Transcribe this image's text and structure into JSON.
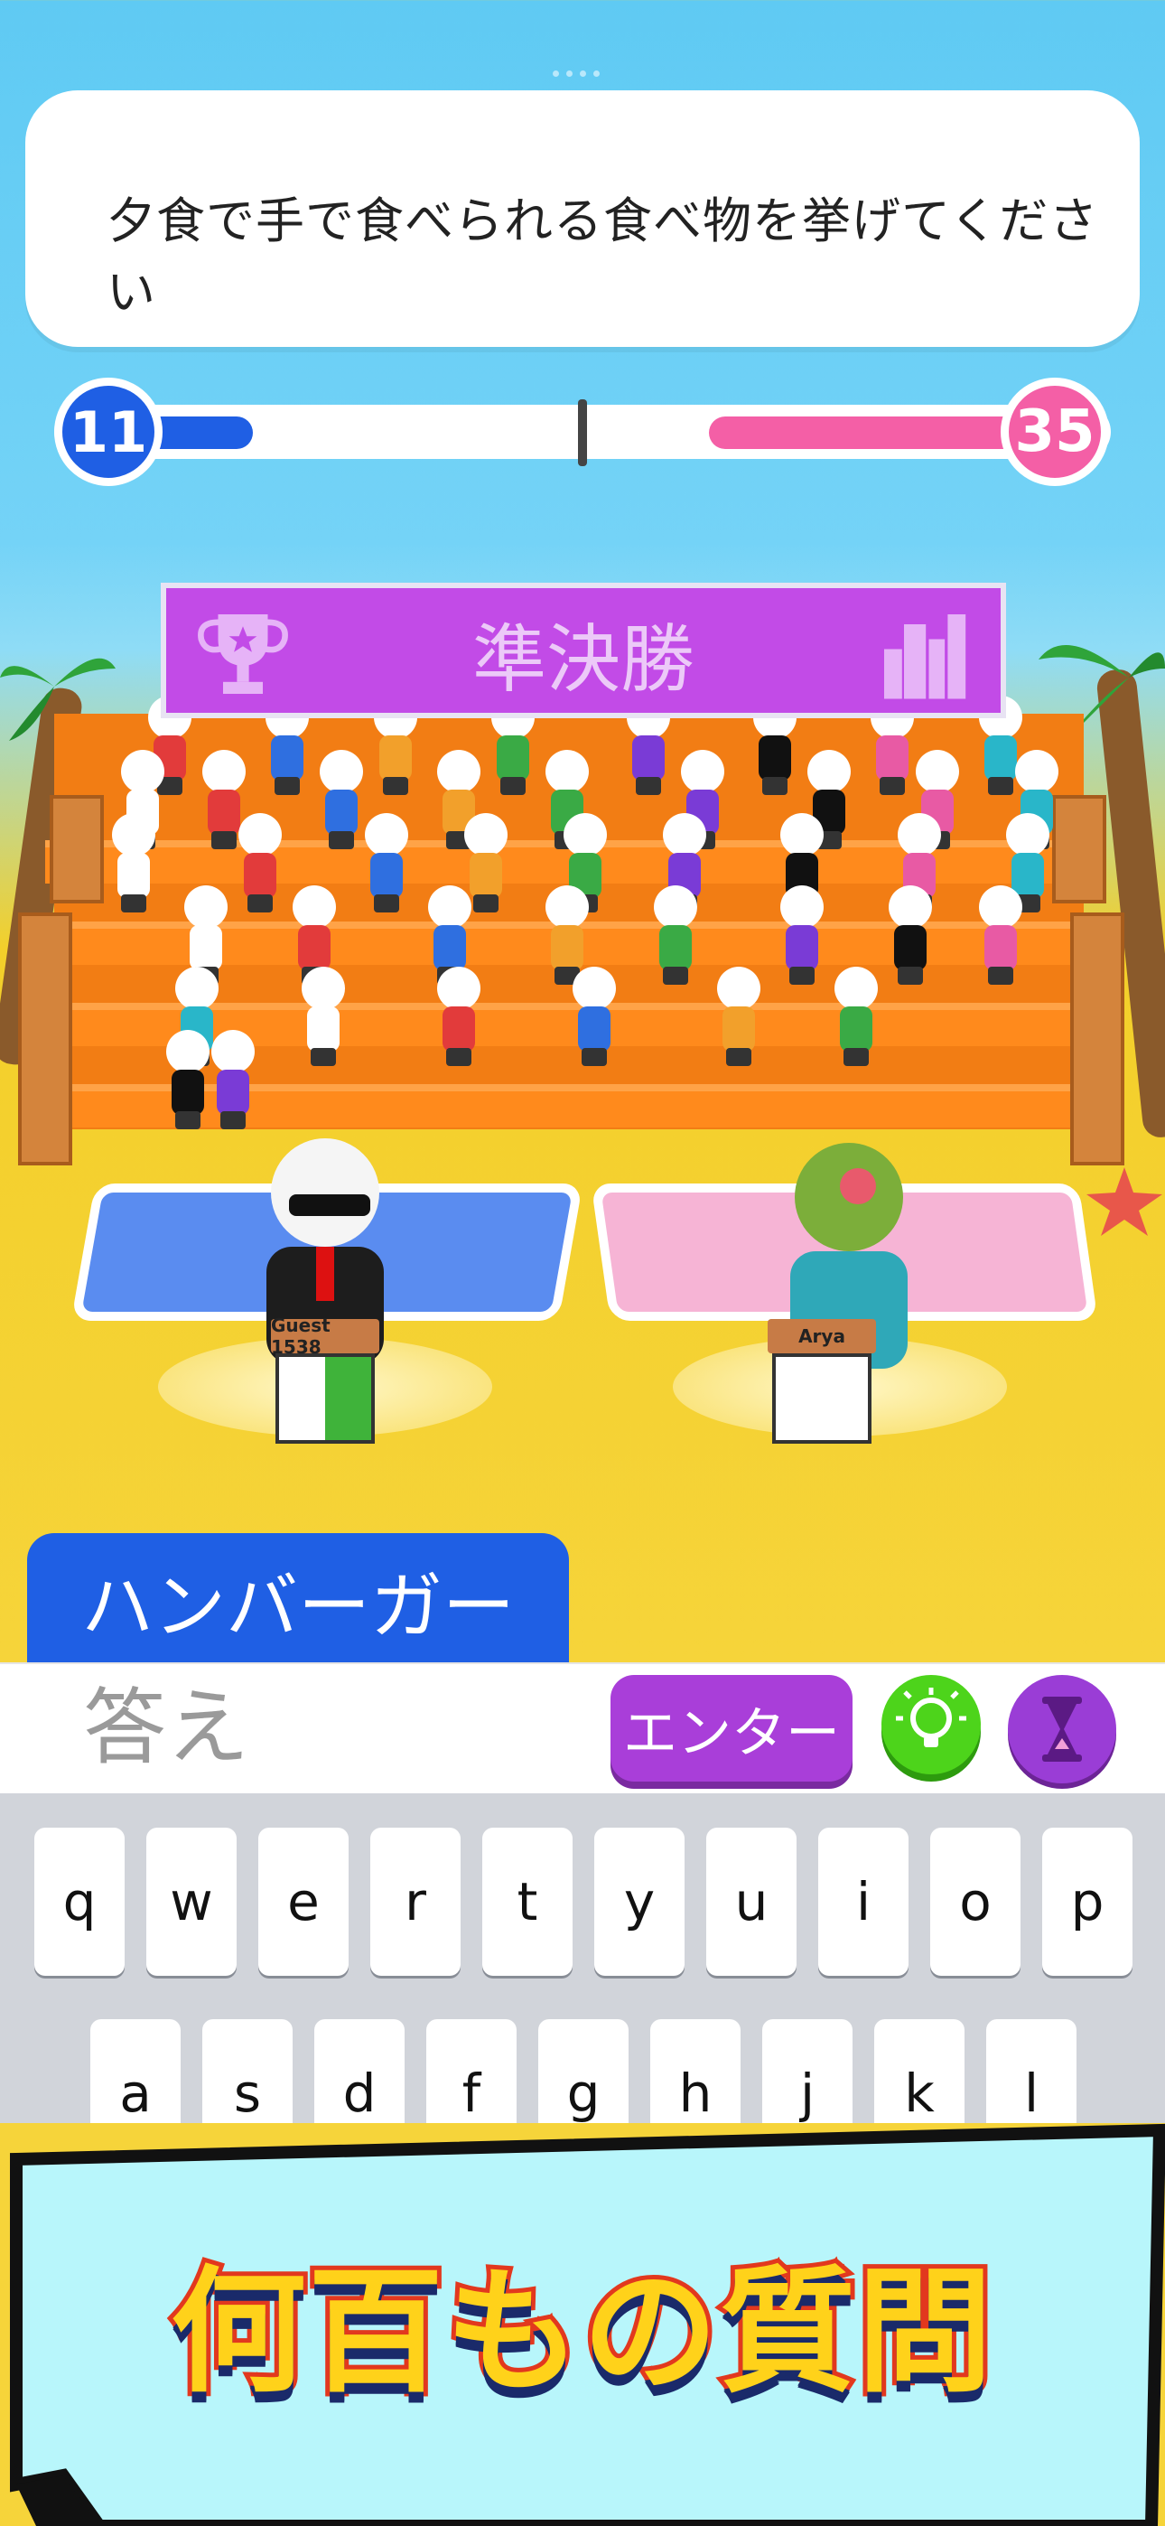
{
  "question": {
    "text": "夕食で手で食べられる食べ物を挙げてください"
  },
  "score": {
    "blue": "11",
    "pink": "35",
    "blue_fraction": 0.14,
    "pink_fraction": 0.34
  },
  "stage": {
    "title": "準決勝"
  },
  "players": {
    "left_name": "Guest 1538",
    "right_name": "Arya"
  },
  "answer": {
    "text": "ハンバーガー"
  },
  "input": {
    "placeholder": "答え",
    "enter_label": "エンター"
  },
  "icons": {
    "hint": "lightbulb-icon",
    "timer": "hourglass-icon",
    "trophy": "trophy-icon",
    "city": "city-icon"
  },
  "keyboard": {
    "row1": [
      "q",
      "w",
      "e",
      "r",
      "t",
      "y",
      "u",
      "i",
      "o",
      "p"
    ],
    "row2": [
      "a",
      "s",
      "d",
      "f",
      "g",
      "h",
      "j",
      "k",
      "l"
    ]
  },
  "promo": {
    "text": "何百もの質問"
  },
  "colors": {
    "blue_team": "#1f5fe4",
    "pink_team": "#f45fa6",
    "enter": "#a93ed9",
    "hint": "#4dd41b"
  }
}
